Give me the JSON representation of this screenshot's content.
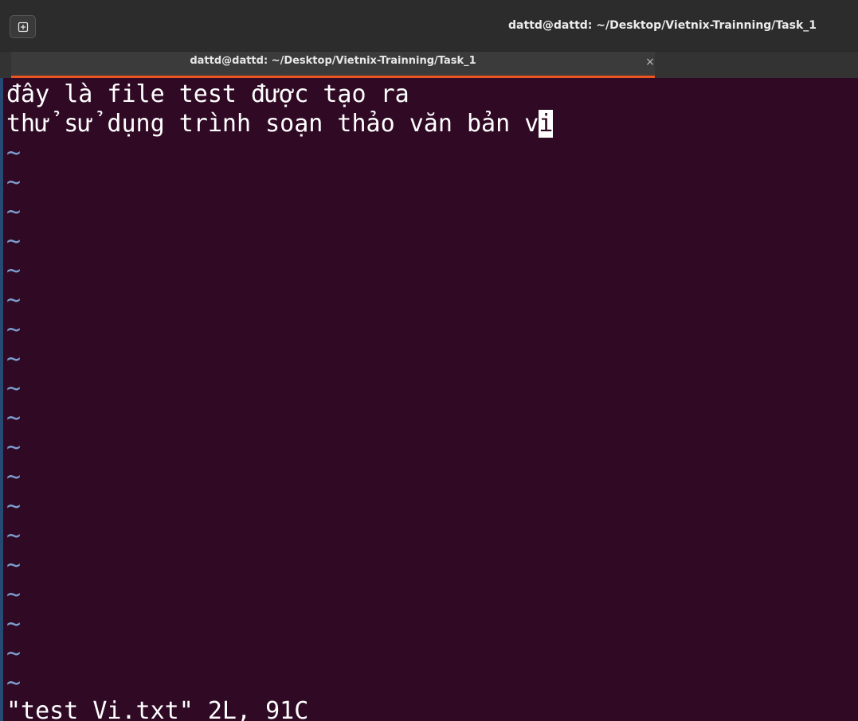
{
  "window": {
    "title": "dattd@dattd: ~/Desktop/Vietnix-Trainning/Task_1",
    "new_tab_icon": "new-tab-icon"
  },
  "tab": {
    "label": "dattd@dattd: ~/Desktop/Vietnix-Trainning/Task_1",
    "close_glyph": "×",
    "accent_color": "#e95420"
  },
  "editor": {
    "lines": [
      "đây là file test được tạo ra",
      "thử sử dụng trình soạn thảo văn bản v"
    ],
    "cursor_char": "i",
    "empty_line_marker": "~",
    "empty_line_count": 19,
    "status_line": "\"test Vi.txt\" 2L, 91C",
    "background": "#300a24",
    "tilde_color": "#7d9dd0"
  }
}
